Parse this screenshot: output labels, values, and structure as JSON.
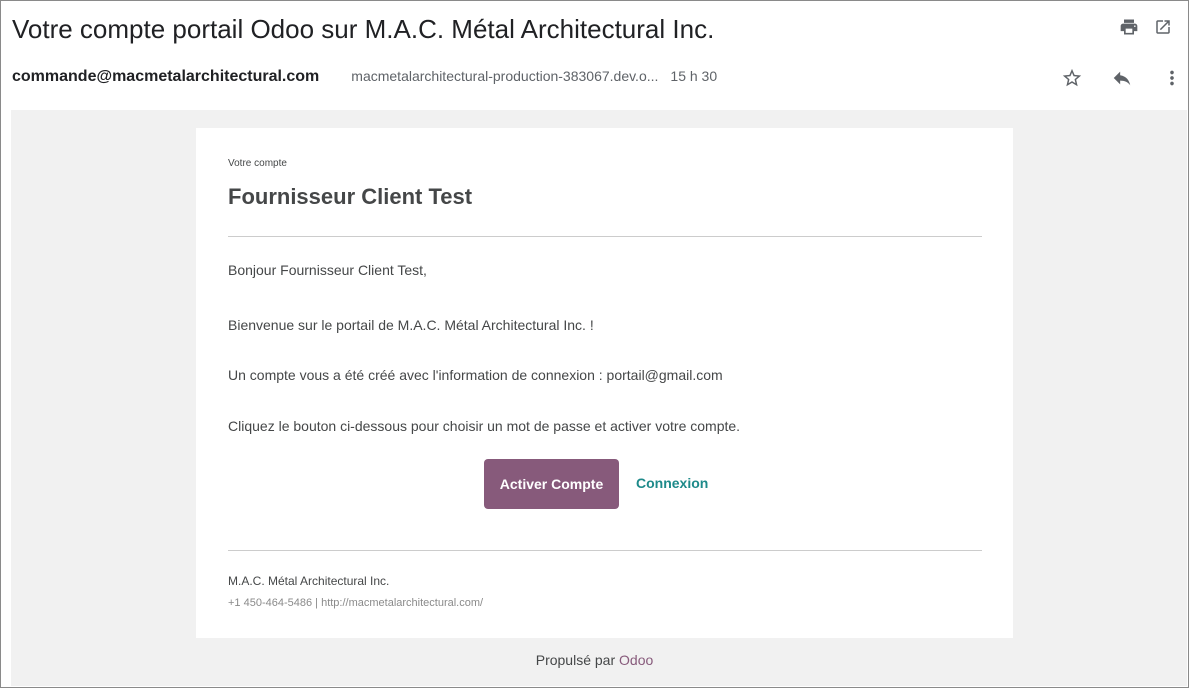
{
  "email": {
    "subject": "Votre compte portail Odoo sur M.A.C. Métal Architectural Inc.",
    "sender": "commande@macmetalarchitectural.com",
    "via": "macmetalarchitectural-production-383067.dev.o...",
    "time": "15 h 30"
  },
  "body": {
    "eyebrow": "Votre compte",
    "title": "Fournisseur Client Test",
    "greeting": "Bonjour Fournisseur Client Test,",
    "welcome": "Bienvenue sur le portail de M.A.C. Métal Architectural Inc. !",
    "account_info": "Un compte vous a été créé avec l'information de connexion :  portail@gmail.com",
    "instruction": "Cliquez le bouton ci-dessous pour choisir un mot de passe et activer votre compte.",
    "activate_label": "Activer Compte",
    "login_label": "Connexion",
    "footer_company": "M.A.C. Métal Architectural Inc.",
    "footer_contact": "+1 450-464-5486 | http://macmetalarchitectural.com/"
  },
  "powered": {
    "prefix": "Propulsé par",
    "brand": "Odoo"
  },
  "icons": {
    "print": "printer-icon",
    "open": "open-in-new-icon",
    "star": "star-outline-icon",
    "reply": "reply-icon",
    "more": "more-vert-icon"
  },
  "colors": {
    "brand": "#875a7b",
    "link": "#1e8a8a"
  }
}
